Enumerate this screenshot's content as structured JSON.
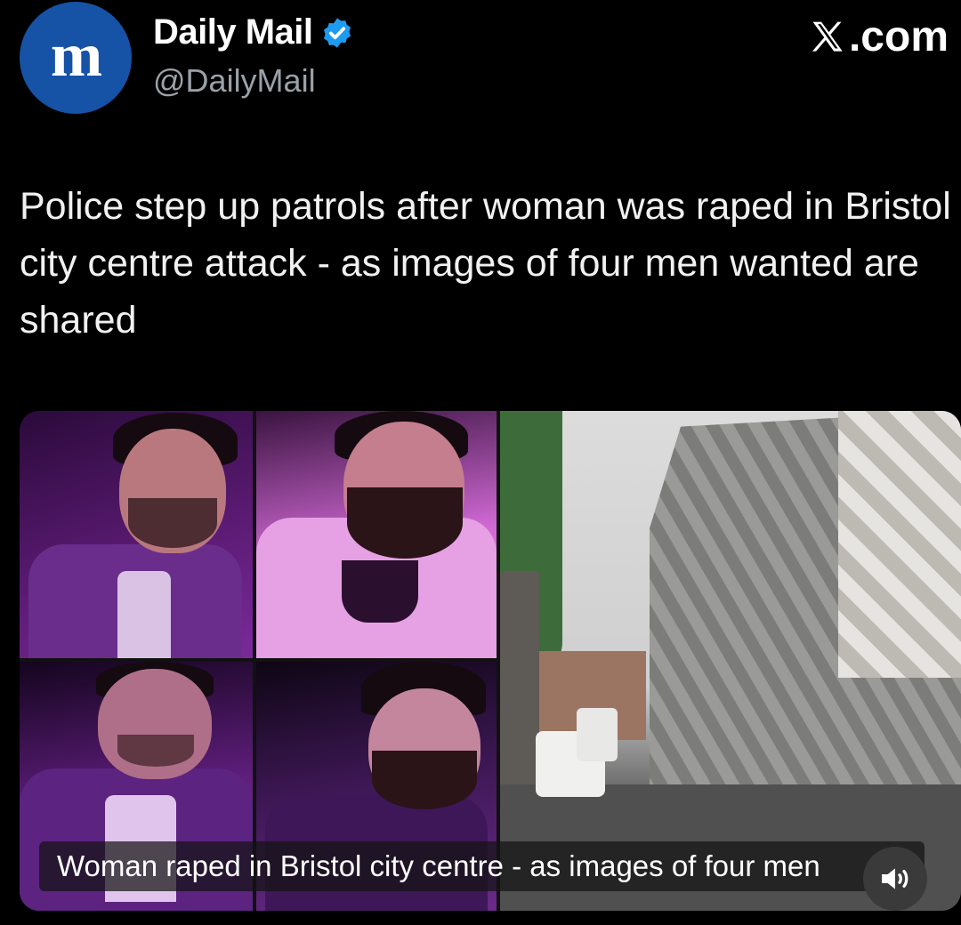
{
  "account": {
    "display_name": "Daily Mail",
    "handle": "@DailyMail",
    "avatar_letter": "m",
    "verified": true,
    "avatar_color": "#1652a6",
    "verified_color": "#1d9bf0"
  },
  "site_label": ".com",
  "tweet": {
    "text": "Police step up patrols after woman was raped in Bristol city centre attack - as images of four men wanted are shared"
  },
  "media": {
    "caption": "Woman raped in Bristol city centre - as images of four men",
    "panels": [
      {
        "name": "suspect-photo-1",
        "icon": "person-photo"
      },
      {
        "name": "suspect-photo-2",
        "icon": "person-photo"
      },
      {
        "name": "suspect-photo-3",
        "icon": "person-photo"
      },
      {
        "name": "suspect-photo-4",
        "icon": "person-photo"
      },
      {
        "name": "street-photo",
        "icon": "street-scene"
      }
    ],
    "sound_icon": "speaker-icon"
  }
}
